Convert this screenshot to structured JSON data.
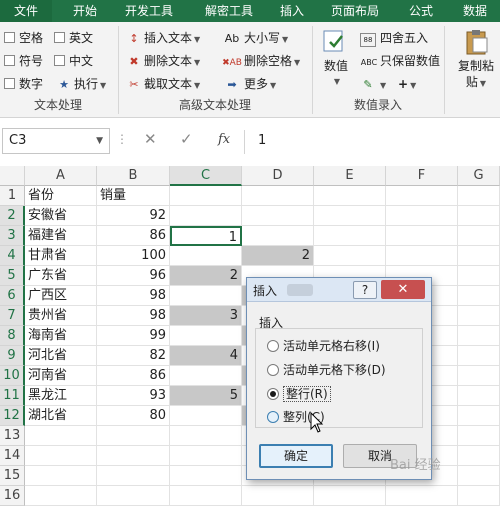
{
  "tabs": [
    "文件",
    "开始",
    "开发工具",
    "解密工具",
    "插入",
    "页面布局",
    "公式",
    "数据"
  ],
  "ribbon": {
    "text_group": {
      "checkboxes": [
        "空格",
        "英文",
        "符号",
        "中文",
        "数字"
      ],
      "exec_label": "执行",
      "label": "文本处理"
    },
    "adv_group": {
      "insert_text": "插入文本",
      "delete_text": "删除文本",
      "extract_text": "截取文本",
      "case": "大小写",
      "delete_space": "删除空格",
      "more": "更多",
      "label": "高级文本处理"
    },
    "value_group": {
      "value_label": "数值",
      "round": "四舍五入",
      "keep_value": "只保留数值",
      "label": "数值录入"
    },
    "paste_label_1": "复制粘",
    "paste_label_2": "贴"
  },
  "formula_bar": {
    "name_box": "C3",
    "formula": "1"
  },
  "grid": {
    "columns": [
      "A",
      "B",
      "C",
      "D",
      "E",
      "F",
      "G"
    ],
    "rows": [
      "1",
      "2",
      "3",
      "4",
      "5",
      "6",
      "7",
      "8",
      "9",
      "10",
      "11",
      "12",
      "13",
      "14",
      "15",
      "16"
    ],
    "col_a": [
      "省份",
      "安徽省",
      "福建省",
      "甘肃省",
      "广东省",
      "广西区",
      "贵州省",
      "海南省",
      "河北省",
      "河南省",
      "黑龙江",
      "湖北省"
    ],
    "col_b_header": "销量",
    "col_b": [
      92,
      86,
      100,
      96,
      98,
      98,
      99,
      82,
      86,
      93,
      80
    ],
    "c_values": [
      "1",
      "2",
      "3",
      "4",
      "5"
    ],
    "d_values": [
      "2"
    ]
  },
  "dialog": {
    "title": "插入",
    "help": "?",
    "close": "✕",
    "group_label": "插入",
    "options": [
      "活动单元格右移(I)",
      "活动单元格下移(D)",
      "整行(R)",
      "整列(C)"
    ],
    "ok": "确定",
    "cancel": "取消"
  },
  "watermark": "Bai 经验"
}
